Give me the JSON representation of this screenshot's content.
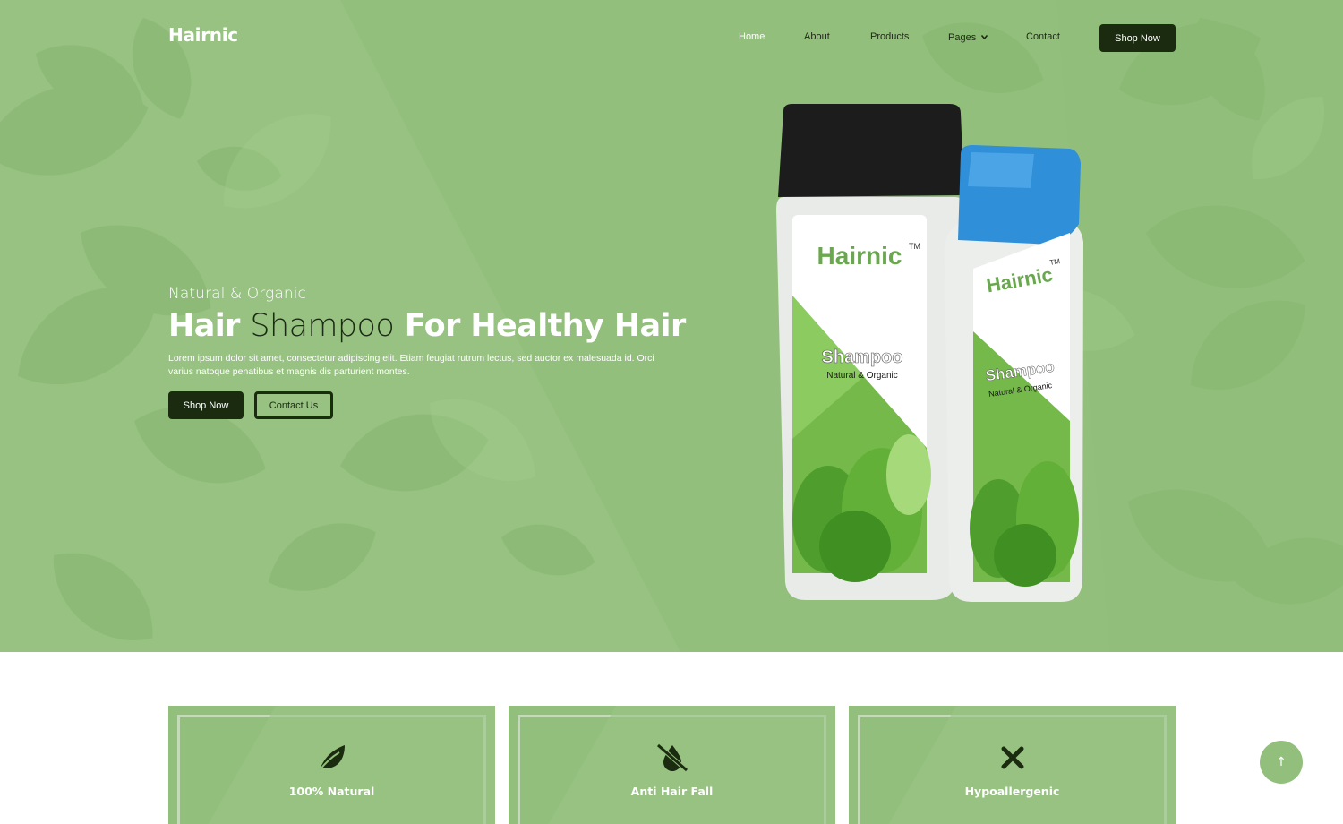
{
  "brand": {
    "name": "Hairnic"
  },
  "nav": {
    "items": [
      {
        "label": "Home"
      },
      {
        "label": "About"
      },
      {
        "label": "Products"
      },
      {
        "label": "Pages"
      },
      {
        "label": "Contact"
      }
    ],
    "cta_label": "Shop Now"
  },
  "hero": {
    "eyebrow": "Natural & Organic",
    "headline": {
      "part1": "Hair",
      "part2": "Shampoo",
      "part3": "For Healthy Hair"
    },
    "description": "Lorem ipsum dolor sit amet, consectetur adipiscing elit. Etiam feugiat rutrum lectus, sed auctor ex malesuada id. Orci varius natoque penatibus et magnis dis parturient montes.",
    "primary_label": "Shop Now",
    "secondary_label": "Contact Us",
    "product": {
      "brand": "Hairnic",
      "trademark": "TM",
      "name": "Shampoo",
      "tagline": "Natural & Organic"
    }
  },
  "features": [
    {
      "title": "100% Natural",
      "icon": "leaf-icon"
    },
    {
      "title": "Anti Hair Fall",
      "icon": "no-drop-icon"
    },
    {
      "title": "Hypoallergenic",
      "icon": "x-icon"
    }
  ],
  "back_to_top": {
    "icon": "arrow-up-icon",
    "glyph": "↑"
  },
  "colors": {
    "primary_green": "#93bf7d",
    "dark": "#1a2b10",
    "white": "#ffffff"
  }
}
